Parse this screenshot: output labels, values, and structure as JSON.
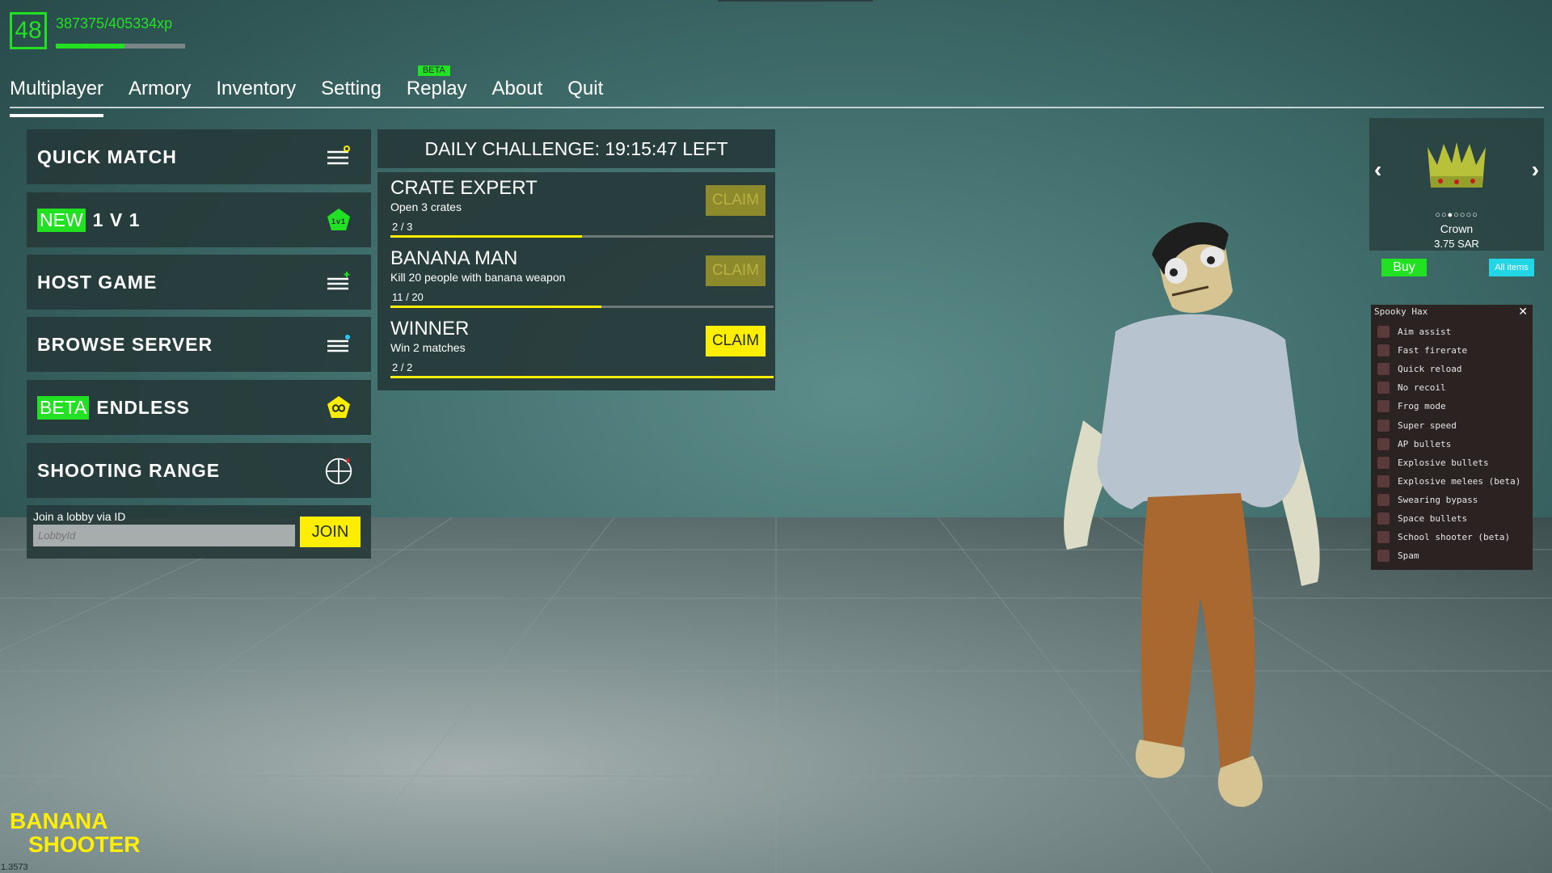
{
  "player": {
    "level": "48",
    "xp_text": "387375/405334xp",
    "xp_progress": 0.53
  },
  "tabs": [
    {
      "label": "Multiplayer",
      "active": true
    },
    {
      "label": "Armory"
    },
    {
      "label": "Inventory"
    },
    {
      "label": "Setting"
    },
    {
      "label": "Replay",
      "badge": "BETA"
    },
    {
      "label": "About"
    },
    {
      "label": "Quit"
    }
  ],
  "menu": {
    "quick_match": "QUICK MATCH",
    "one_v_one_badge": "NEW",
    "one_v_one": "1 V 1",
    "one_v_one_icon_text": "1v1",
    "host_game": "HOST GAME",
    "browse_server": "BROWSE SERVER",
    "endless_badge": "BETA",
    "endless": "ENDLESS",
    "shooting_range": "SHOOTING RANGE"
  },
  "join": {
    "label": "Join a lobby via ID",
    "placeholder": "LobbyId",
    "button": "JOIN"
  },
  "daily": {
    "header": "DAILY CHALLENGE: 19:15:47 LEFT",
    "challenges": [
      {
        "title": "CRATE EXPERT",
        "desc": "Open 3 crates",
        "progress_text": "2 / 3",
        "progress": 0.5,
        "claim": "CLAIM",
        "claimable": false
      },
      {
        "title": "BANANA MAN",
        "desc": "Kill 20 people with banana weapon",
        "progress_text": "11 / 20",
        "progress": 0.55,
        "claim": "CLAIM",
        "claimable": false
      },
      {
        "title": "WINNER",
        "desc": "Win 2 matches",
        "progress_text": "2 / 2",
        "progress": 1.0,
        "claim": "CLAIM",
        "claimable": true
      }
    ]
  },
  "store": {
    "item_name": "Crown",
    "price": "3.75 SAR",
    "page_indicator": "○○●○○○○",
    "buy": "Buy",
    "all_items": "All items"
  },
  "hax": {
    "title": "Spooky Hax",
    "close": "✕",
    "options": [
      "Aim assist",
      "Fast firerate",
      "Quick reload",
      "No recoil",
      "Frog mode",
      "Super speed",
      "AP bullets",
      "Explosive bullets",
      "Explosive melees (beta)",
      "Swearing bypass",
      "Space bullets",
      "School shooter (beta)",
      "Spam"
    ]
  },
  "logo": {
    "line1": "BANANA",
    "line2": "SHOOTER"
  },
  "version": "1.3573",
  "colors": {
    "green": "#22e022",
    "yellow": "#ffee00",
    "panel": "#263838",
    "cyan": "#22d6e6"
  }
}
